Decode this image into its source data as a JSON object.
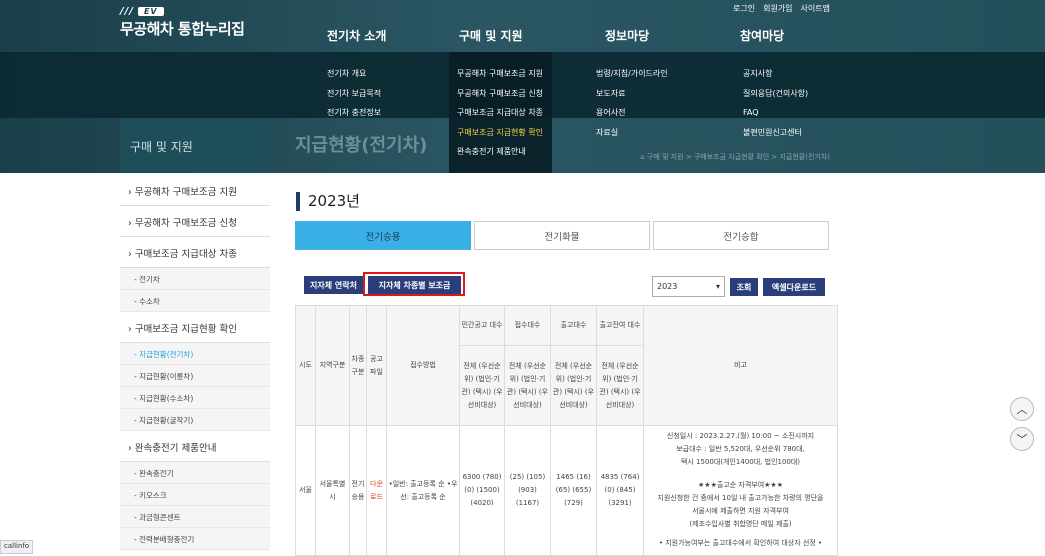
{
  "header": {
    "logo_tag": "EV",
    "logo_name": "무공해차 통합누리집",
    "util": [
      "로그인",
      "회원가입",
      "사이트맵"
    ],
    "gnb": [
      "전기차 소개",
      "구매 및 지원",
      "정보마당",
      "참여마당"
    ],
    "sub_menus": [
      [
        "전기차 개요",
        "전기차 보급목적",
        "전기차 충전정보"
      ],
      [
        "무공해차 구매보조금 지원",
        "무공해차 구매보조금 신청",
        "구매보조금 지급대상 차종",
        "구매보조금 지급현황 확인",
        "완속충전기 제품안내"
      ],
      [
        "법령/지침/가이드라인",
        "보도자료",
        "용어사전",
        "자료실"
      ],
      [
        "공지사항",
        "질의응답(건의사항)",
        "FAQ",
        "불편민원신고센터"
      ]
    ],
    "section_title": "구매 및 지원",
    "page_title": "지급현황(전기차)",
    "breadcrumb": "⌂ 구매 및 지원 > 구매보조금 지급현황 확인 > 지급현황(전기차)"
  },
  "lnb": [
    {
      "type": "m",
      "label": "› 무공해차 구매보조금 지원"
    },
    {
      "type": "m",
      "label": "› 무공해차 구매보조금 신청"
    },
    {
      "type": "m",
      "label": "› 구매보조금 지급대상 차종"
    },
    {
      "type": "s",
      "label": "- 전기차"
    },
    {
      "type": "s",
      "label": "- 수소차"
    },
    {
      "type": "m",
      "label": "› 구매보조금 지급현황 확인"
    },
    {
      "type": "s",
      "label": "- 지급현황(전기차)",
      "active": true
    },
    {
      "type": "s",
      "label": "- 지급현황(이륜차)"
    },
    {
      "type": "s",
      "label": "- 지급현황(수소차)"
    },
    {
      "type": "s",
      "label": "- 지급현황(굴착기)"
    },
    {
      "type": "m",
      "label": "› 완속충전기 제품안내"
    },
    {
      "type": "s",
      "label": "- 완속충전기"
    },
    {
      "type": "s",
      "label": "- 키오스크"
    },
    {
      "type": "s",
      "label": "- 과금형콘센트"
    },
    {
      "type": "s",
      "label": "- 전력분배형충전기"
    }
  ],
  "main": {
    "year": "2023년",
    "tabs": [
      "전기승용",
      "전기화물",
      "전기승합"
    ],
    "btn_contact": "지자체 연락처",
    "btn_subsidy": "지자체 차종별 보조금",
    "year_select": "2023",
    "btn_search": "조회",
    "btn_excel": "엑셀다운로드"
  },
  "table": {
    "h_sido": "시도",
    "h_region": "지역구분",
    "h_cartype": "차종 구분",
    "h_notice": "공고 파일",
    "h_method": "접수방법",
    "h_private": "민간공고 대수",
    "h_received": "접수대수",
    "h_released": "출고대수",
    "h_remaining": "출고잔여 대수",
    "h_note": "비고",
    "sub_header": "전체 (우선순위) (법인·기관) (택시) (우선비대상)",
    "row": {
      "sido": "서울",
      "region": "서울특별시",
      "cartype": "전기 승용",
      "notice": "다운 로드",
      "method": "•일반: 출고등록 순 •우선: 출고등록 순",
      "private": "6300 (780) (0) (1500) (4020)",
      "received": "(25) (105) (903) (1167)",
      "released": "1465 (16) (65) (655) (729)",
      "remaining": "4835 (764) (0) (845) (3291)",
      "note1": "신청일시 : 2023.2.27.(월) 10:00 ~ 소진시까지",
      "note2": "보급대수 : 일반 5,520대, 우선순위 780대,",
      "note3": "택시 1500대(개인1400대, 법인100대)",
      "note4": "★★★출고순 자격부여★★★",
      "note5": "지원신청한 건 중에서 10일 내 출고가능한 차량의 명단을",
      "note6": "서울시에 제출하면 지원 자격부여",
      "note7": "(제조수입사별 취합명단 메일 제출)",
      "note8": "• 지원가능여부는 출고대수에서 확인하여 대상자 선정 •"
    }
  },
  "status_bar": "callinfo"
}
